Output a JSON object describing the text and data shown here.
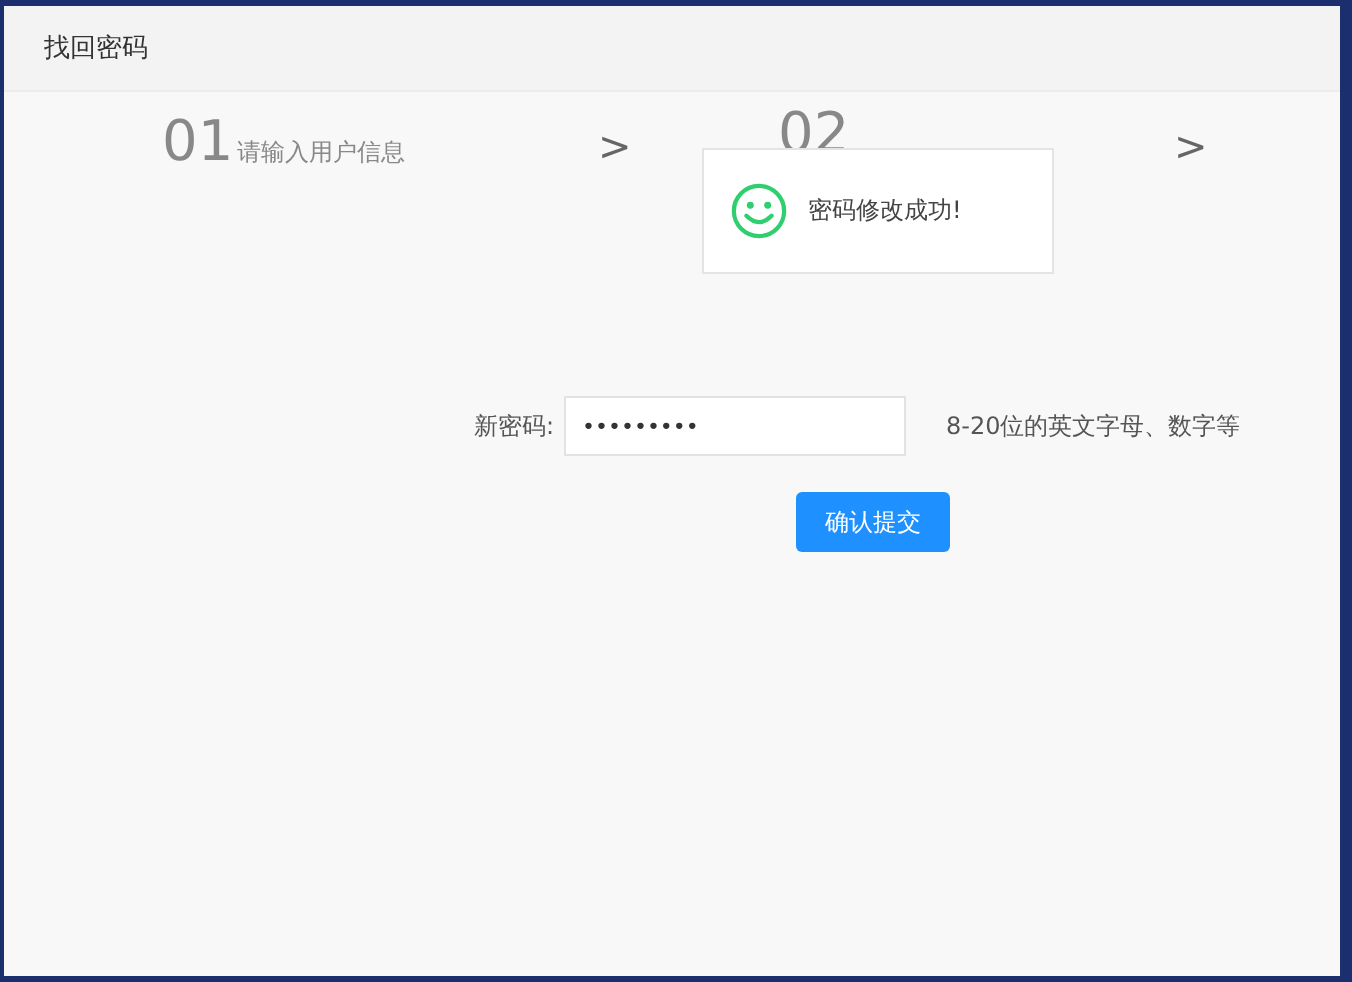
{
  "window": {
    "title": "找回密码"
  },
  "steps": [
    {
      "kind": "step",
      "number": "01",
      "label": "请输入用户信息"
    },
    {
      "kind": "arrow",
      "text": ">"
    },
    {
      "kind": "step",
      "number": "02"
    },
    {
      "kind": "arrow",
      "text": ">"
    }
  ],
  "toast": {
    "message": "密码修改成功!"
  },
  "form": {
    "label": "新密码:",
    "value": "•••••••••",
    "hint": "8-20位的英文字母、数字等",
    "submit": "确认提交"
  }
}
